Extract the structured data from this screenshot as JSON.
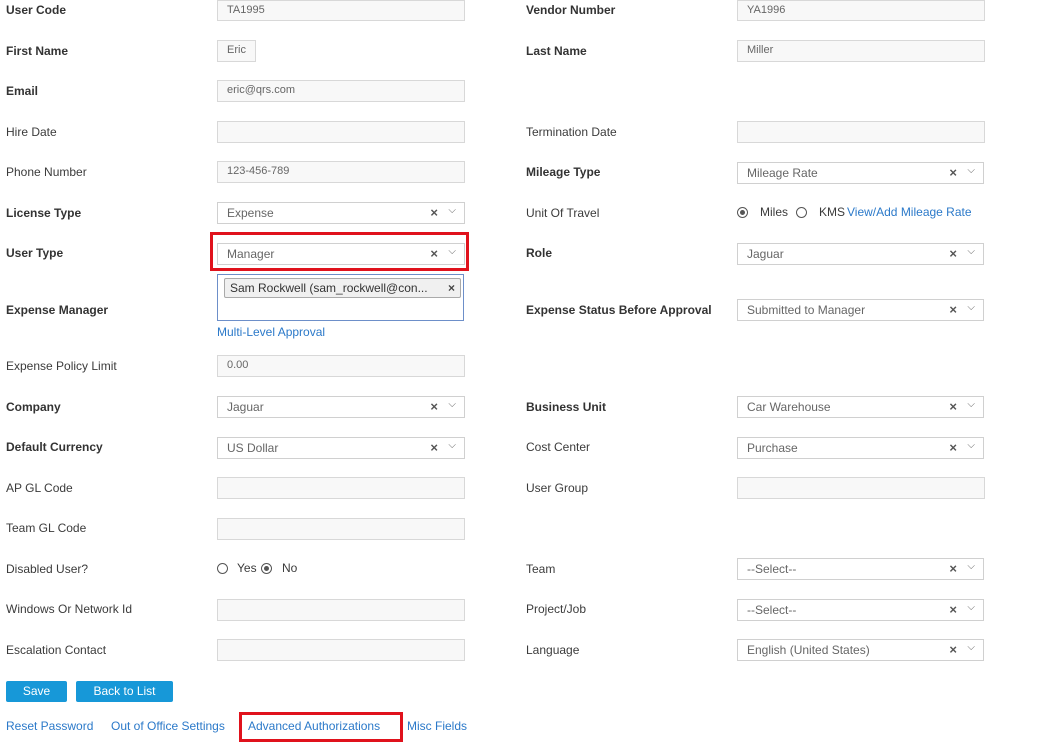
{
  "fields": {
    "user_code": {
      "label": "User Code",
      "value": "TA1995"
    },
    "vendor_number": {
      "label": "Vendor Number",
      "value": "YA1996"
    },
    "first_name": {
      "label": "First Name",
      "value": "Eric"
    },
    "last_name": {
      "label": "Last Name",
      "value": "Miller"
    },
    "email": {
      "label": "Email",
      "value": "eric@qrs.com"
    },
    "hire_date": {
      "label": "Hire Date",
      "value": ""
    },
    "termination_date": {
      "label": "Termination Date",
      "value": ""
    },
    "phone_number": {
      "label": "Phone Number",
      "value": "123-456-789"
    },
    "mileage_type": {
      "label": "Mileage Type",
      "value": "Mileage Rate"
    },
    "license_type": {
      "label": "License Type",
      "value": "Expense"
    },
    "unit_of_travel": {
      "label": "Unit Of Travel",
      "option_miles": "Miles",
      "option_kms": "KMS",
      "selected": "Miles",
      "link": "View/Add Mileage Rate"
    },
    "user_type": {
      "label": "User Type",
      "value": "Manager"
    },
    "role": {
      "label": "Role",
      "value": "Jaguar"
    },
    "expense_manager": {
      "label": "Expense Manager",
      "tag": "Sam Rockwell (sam_rockwell@con...",
      "link": "Multi-Level Approval"
    },
    "expense_status": {
      "label": "Expense Status Before Approval",
      "value": "Submitted to Manager"
    },
    "expense_policy_limit": {
      "label": "Expense Policy Limit",
      "value": "0.00"
    },
    "company": {
      "label": "Company",
      "value": "Jaguar"
    },
    "business_unit": {
      "label": "Business Unit",
      "value": "Car Warehouse"
    },
    "default_currency": {
      "label": "Default Currency",
      "value": "US Dollar"
    },
    "cost_center": {
      "label": "Cost Center",
      "value": "Purchase"
    },
    "ap_gl_code": {
      "label": "AP GL Code",
      "value": ""
    },
    "user_group": {
      "label": "User Group",
      "value": ""
    },
    "team_gl_code": {
      "label": "Team GL Code",
      "value": ""
    },
    "disabled_user": {
      "label": "Disabled User?",
      "option_yes": "Yes",
      "option_no": "No",
      "selected": "No"
    },
    "team": {
      "label": "Team",
      "value": "--Select--"
    },
    "windows_id": {
      "label": "Windows Or Network Id",
      "value": ""
    },
    "project_job": {
      "label": "Project/Job",
      "value": "--Select--"
    },
    "escalation_contact": {
      "label": "Escalation Contact",
      "value": ""
    },
    "language": {
      "label": "Language",
      "value": "English (United States)"
    }
  },
  "buttons": {
    "save": "Save",
    "back": "Back to List"
  },
  "footer_links": {
    "reset_password": "Reset Password",
    "out_of_office": "Out of Office Settings",
    "advanced_auth": "Advanced Authorizations",
    "misc_fields": "Misc Fields"
  },
  "icons": {
    "clear": "×",
    "dropdown": "⌵"
  },
  "colors": {
    "link": "#2b79c9",
    "button": "#1798d8",
    "highlight": "#e0121c"
  }
}
